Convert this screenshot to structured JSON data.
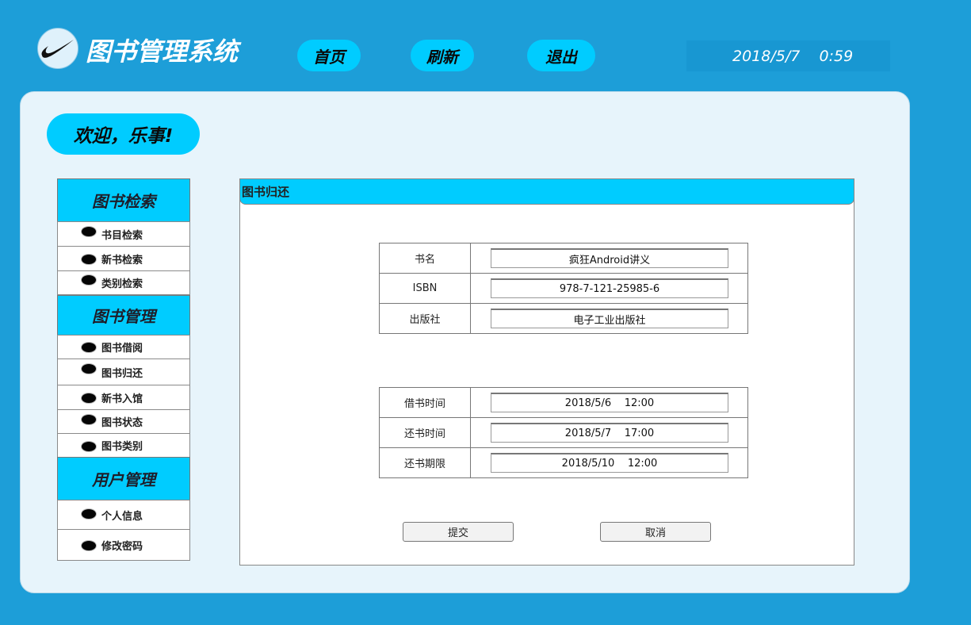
{
  "header": {
    "app_title": "图书管理系统",
    "nav": {
      "home": "首页",
      "refresh": "刷新",
      "logout": "退出"
    },
    "datetime": "2018/5/7    0:59"
  },
  "welcome": "欢迎，乐事!",
  "sidebar": {
    "search_section": "图书检索",
    "search_items": [
      "书目检索",
      "新书检索",
      "类别检索"
    ],
    "manage_section": "图书管理",
    "manage_items": [
      "图书借阅",
      "图书归还",
      "新书入馆",
      "图书状态",
      "图书类别"
    ],
    "user_section": "用户管理",
    "user_items": [
      "个人信息",
      "修改密码"
    ]
  },
  "content": {
    "title": "图书归还",
    "book_info": [
      {
        "label": "书名",
        "value": "疯狂Android讲义"
      },
      {
        "label": "ISBN",
        "value": "978-7-121-25985-6"
      },
      {
        "label": "出版社",
        "value": "电子工业出版社"
      }
    ],
    "time_info": [
      {
        "label": "借书时间",
        "value": "2018/5/6    12:00"
      },
      {
        "label": "还书时间",
        "value": "2018/5/7    17:00"
      },
      {
        "label": "还书期限",
        "value": "2018/5/10    12:00"
      }
    ],
    "submit_label": "提交",
    "cancel_label": "取消"
  },
  "colors": {
    "background": "#1d9ed8",
    "accent": "#00ccff",
    "panel": "#e7f4fb"
  },
  "icons": {
    "logo": "swoosh-logo-icon",
    "bullet": "bullet-dot-icon"
  }
}
